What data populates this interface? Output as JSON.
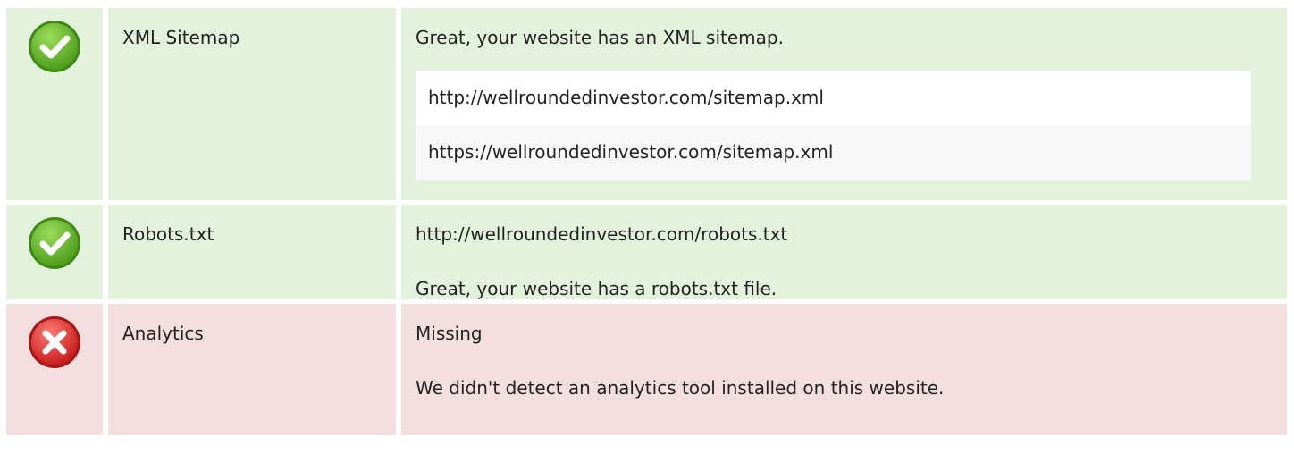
{
  "colors": {
    "success_bg": "#e2f2dc",
    "error_bg": "#f3dfe0",
    "success_icon": "#6cbf2f",
    "error_icon": "#e53935"
  },
  "rows": [
    {
      "status": "success",
      "icon": "check-circle-icon",
      "label": "XML Sitemap",
      "message": "Great, your website has an XML sitemap.",
      "urls": [
        "http://wellroundedinvestor.com/sitemap.xml",
        "https://wellroundedinvestor.com/sitemap.xml"
      ]
    },
    {
      "status": "success",
      "icon": "check-circle-icon",
      "label": "Robots.txt",
      "url": "http://wellroundedinvestor.com/robots.txt",
      "message": "Great, your website has a robots.txt file."
    },
    {
      "status": "error",
      "icon": "x-circle-icon",
      "label": "Analytics",
      "status_text": "Missing",
      "message": "We didn't detect an analytics tool installed on this website."
    }
  ]
}
